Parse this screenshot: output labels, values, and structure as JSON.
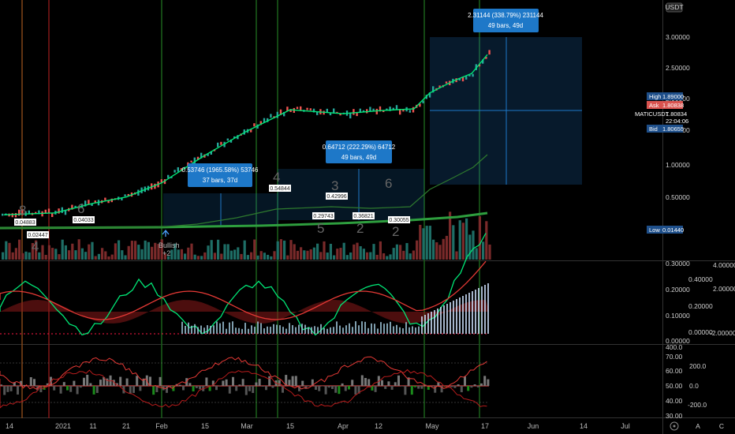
{
  "symbol": "MATICUSDT",
  "currency_badge": "USDT",
  "chart_data": [
    {
      "type": "line",
      "title": "",
      "xlabel": "",
      "ylabel": "",
      "scale": "log",
      "ylim": [
        0.006,
        4.5
      ],
      "y_ticks": [
        "3.00000",
        "2.50000",
        "2.00000",
        "1.50000",
        "1.00000",
        "0.50000"
      ],
      "x_tick_labels": [
        "14",
        "2021",
        "11",
        "21",
        "Feb",
        "15",
        "Mar",
        "15",
        "Apr",
        "12",
        "May",
        "17",
        "Jun",
        "14",
        "Jul"
      ],
      "price_tags": [
        {
          "label": "High",
          "value": "1.89000",
          "color": "#1e4f8a"
        },
        {
          "label": "Ask",
          "value": "1.80838",
          "color": "#d9534f"
        },
        {
          "label": "MATICUSDT",
          "value": "1.80834",
          "color": "#000000"
        },
        {
          "label": "",
          "value": "22:04:06",
          "color": "#000000"
        },
        {
          "label": "Bid",
          "value": "1.80655",
          "color": "#1e4f8a"
        },
        {
          "label": "Low",
          "value": "0.01440",
          "color": "#1e4f8a"
        }
      ],
      "measure_boxes": [
        {
          "line1": "0.53746 (1965.58%) 53746",
          "line2": "37 bars, 37d"
        },
        {
          "line1": "0.64712 (222.29%) 64712",
          "line2": "49 bars, 49d"
        },
        {
          "line1": "2.31144 (338.79%) 231144",
          "line2": "49 bars, 49d"
        }
      ],
      "price_labels": [
        "0.04883",
        "0.02447",
        "0.04033",
        "0.54844",
        "0.42996",
        "0.29743",
        "0.36821",
        "0.30055"
      ],
      "wave_labels": [
        "8",
        "4",
        "6",
        "4",
        "3",
        "5",
        "2",
        "6",
        "2"
      ],
      "signal_label": "Bullish",
      "signal_sub": "+2",
      "series": [
        {
          "name": "",
          "x": [
            "Dec 14",
            "Jan 1",
            "Jan 11",
            "Jan 21",
            "Feb 1",
            "Feb 15",
            "Mar 1",
            "Mar 15",
            "Apr 1",
            "Apr 12",
            "Apr 24",
            "May 1",
            "May 8",
            "May 14",
            "May 18"
          ],
          "values": [
            0.018,
            0.019,
            0.025,
            0.03,
            0.045,
            0.1,
            0.2,
            0.37,
            0.33,
            0.36,
            0.38,
            0.6,
            0.85,
            1.05,
            1.81
          ]
        }
      ]
    },
    {
      "type": "line",
      "title": "",
      "left_axis_ticks": [
        "0.30000",
        "0.20000",
        "0.10000",
        "0.00000"
      ],
      "right_axis_ticks_a": [
        "0.40000",
        "0.20000",
        "0.00000"
      ],
      "right_axis_ticks_b": [
        "4.00000",
        "2.00000",
        "-2.00000"
      ]
    },
    {
      "type": "line",
      "title": "",
      "left_axis_ticks": [
        "400.0",
        "70.00",
        "60.00",
        "50.00",
        "40.00",
        "30.00"
      ],
      "right_axis_ticks": [
        "200.0",
        "0.0",
        "-200.0"
      ]
    }
  ],
  "colors": {
    "up": "#26a69a",
    "down": "#ef5350",
    "green_line": "#00e676",
    "red_line": "#ff1744",
    "box_blue": "#1e78c8",
    "panel_border": "#333333"
  },
  "icons": [
    "gear-icon",
    "gear-icon",
    "gear-icon"
  ],
  "corner_labels": [
    "A",
    "B",
    "C"
  ]
}
